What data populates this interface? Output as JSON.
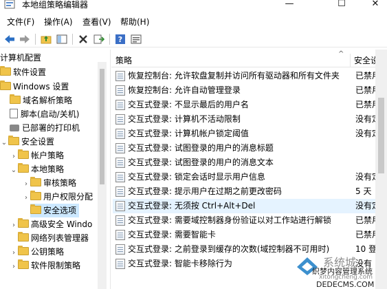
{
  "window": {
    "title": "本地组策略编辑器",
    "minimize_glyph": "—",
    "maximize_glyph": "☐",
    "close_glyph": "✕"
  },
  "menu": [
    "文件(F)",
    "操作(A)",
    "查看(V)",
    "帮助(H)"
  ],
  "toolbar": {
    "icons": [
      "back-arrow-icon",
      "forward-arrow-icon",
      "up-folder-icon",
      "show-hide-tree-icon",
      "delete-icon",
      "export-list-icon",
      "help-icon",
      "properties-icon"
    ]
  },
  "tree": {
    "items": [
      {
        "label": "计算机配置",
        "indent": 0,
        "icon": "computer"
      },
      {
        "label": "软件设置",
        "indent": 1,
        "icon": "folder"
      },
      {
        "label": "Windows 设置",
        "indent": 1,
        "icon": "folder"
      },
      {
        "label": "域名解析策略",
        "indent": 2,
        "icon": "folder"
      },
      {
        "label": "脚本(启动/关机)",
        "indent": 2,
        "icon": "doc"
      },
      {
        "label": "已部署的打印机",
        "indent": 2,
        "icon": "printer"
      },
      {
        "label": "安全设置",
        "indent": 2,
        "icon": "folder",
        "expanded": true
      },
      {
        "label": "帐户策略",
        "indent": 3,
        "icon": "folder"
      },
      {
        "label": "本地策略",
        "indent": 3,
        "icon": "folder",
        "expanded": true
      },
      {
        "label": "审核策略",
        "indent": 4,
        "icon": "folder"
      },
      {
        "label": "用户权限分配",
        "indent": 4,
        "icon": "folder"
      },
      {
        "label": "安全选项",
        "indent": 4,
        "icon": "folder",
        "selected": true
      },
      {
        "label": "高级安全 Windo",
        "indent": 3,
        "icon": "folder"
      },
      {
        "label": "网络列表管理器",
        "indent": 3,
        "icon": "folder"
      },
      {
        "label": "公钥策略",
        "indent": 3,
        "icon": "folder"
      },
      {
        "label": "软件限制策略",
        "indent": 3,
        "icon": "folder"
      }
    ]
  },
  "list": {
    "col_policy": "策略",
    "col_setting": "安全设",
    "rows": [
      {
        "name": "恢复控制台: 允许软盘复制并访问所有驱动器和所有文件夹",
        "value": "已禁用"
      },
      {
        "name": "恢复控制台: 允许自动管理登录",
        "value": "已禁用"
      },
      {
        "name": "交互式登录: 不显示最后的用户名",
        "value": "已禁用"
      },
      {
        "name": "交互式登录: 计算机不活动限制",
        "value": "没有定"
      },
      {
        "name": "交互式登录: 计算机帐户锁定阈值",
        "value": "没有定"
      },
      {
        "name": "交互式登录: 试图登录的用户的消息标题",
        "value": ""
      },
      {
        "name": "交互式登录: 试图登录的用户的消息文本",
        "value": ""
      },
      {
        "name": "交互式登录: 锁定会话时显示用户信息",
        "value": "没有定"
      },
      {
        "name": "交互式登录: 提示用户在过期之前更改密码",
        "value": "5 天"
      },
      {
        "name": "交互式登录: 无须按 Ctrl+Alt+Del",
        "value": "没有定",
        "highlight": true
      },
      {
        "name": "交互式登录: 需要域控制器身份验证以对工作站进行解锁",
        "value": "已禁用"
      },
      {
        "name": "交互式登录: 需要智能卡",
        "value": "已禁用"
      },
      {
        "name": "交互式登录: 之前登录到缓存的次数(域控制器不可用时)",
        "value": "10 登"
      },
      {
        "name": "交互式登录: 智能卡移除行为",
        "value": "没有"
      }
    ]
  },
  "watermark": {
    "line1": "系统城",
    "line2": "织梦内容管理系统",
    "line3": "xitongcheng.com",
    "line4": "DEDECMS.COM"
  },
  "colors": {
    "selection": "#cce8ff",
    "row_highlight": "#e5f3ff",
    "watermark": "#1b7cc6"
  }
}
